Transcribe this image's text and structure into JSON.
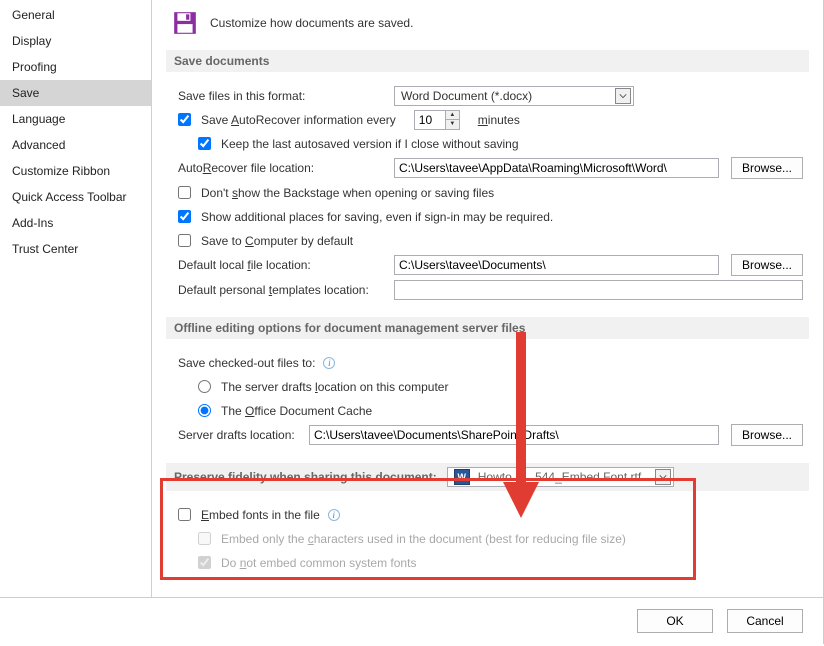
{
  "sidebar": {
    "items": [
      {
        "label": "General"
      },
      {
        "label": "Display"
      },
      {
        "label": "Proofing"
      },
      {
        "label": "Save"
      },
      {
        "label": "Language"
      },
      {
        "label": "Advanced"
      },
      {
        "label": "Customize Ribbon"
      },
      {
        "label": "Quick Access Toolbar"
      },
      {
        "label": "Add-Ins"
      },
      {
        "label": "Trust Center"
      }
    ],
    "selected_index": 3
  },
  "header": {
    "description": "Customize how documents are saved."
  },
  "sections": {
    "save_documents": {
      "title": "Save documents",
      "format_label": "Save files in this format:",
      "format_value": "Word Document (*.docx)",
      "autorecover_label_pre": "Save ",
      "autorecover_label_u": "A",
      "autorecover_label_post": "utoRecover information every",
      "autorecover_minutes": "10",
      "minutes_u": "m",
      "minutes_post": "inutes",
      "keep_last_label": "Keep the last autosaved version if I close without saving",
      "autorec_loc_label_pre": "Auto",
      "autorec_loc_label_u": "R",
      "autorec_loc_label_post": "ecover file location:",
      "autorec_loc_value": "C:\\Users\\tavee\\AppData\\Roaming\\Microsoft\\Word\\",
      "browse": "Browse...",
      "dont_show_pre": "Don't ",
      "dont_show_u": "s",
      "dont_show_post": "how the Backstage when opening or saving files",
      "show_additional": "Show additional places for saving, even if sign-in may be required.",
      "save_to_computer_pre": "Save to ",
      "save_to_computer_u": "C",
      "save_to_computer_post": "omputer by default",
      "default_local_pre": "Default local ",
      "default_local_u": "f",
      "default_local_post": "ile location:",
      "default_local_value": "C:\\Users\\tavee\\Documents\\",
      "templates_pre": "Default personal ",
      "templates_u": "t",
      "templates_post": "emplates location:",
      "templates_value": ""
    },
    "offline": {
      "title": "Offline editing options for document management server files",
      "save_checked_out": "Save checked-out files to:",
      "radio1_pre": "The server drafts ",
      "radio1_u": "l",
      "radio1_post": "ocation on this computer",
      "radio2_pre": "The ",
      "radio2_u": "O",
      "radio2_post": "ffice Document Cache",
      "server_drafts_label": "Server drafts location:",
      "server_drafts_value": "C:\\Users\\tavee\\Documents\\SharePoint Drafts\\"
    },
    "preserve": {
      "title": "Preserve fidelity when sharing this document:",
      "doc_name": "Howto       544_Embed Font.rtf",
      "embed_pre": "E",
      "embed_post": "mbed fonts in the file",
      "embed_only_pre": "Embed only the ",
      "embed_only_u": "c",
      "embed_only_post": "haracters used in the document (best for reducing file size)",
      "do_not_embed_pre": "Do ",
      "do_not_embed_u": "n",
      "do_not_embed_post": "ot embed common system fonts"
    }
  },
  "footer": {
    "ok": "OK",
    "cancel": "Cancel"
  }
}
